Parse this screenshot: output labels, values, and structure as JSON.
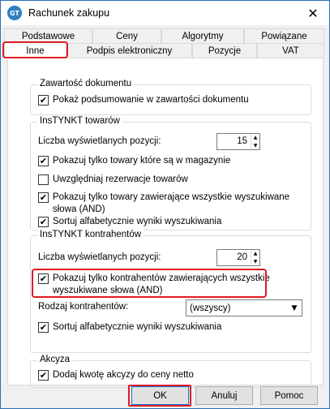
{
  "window": {
    "title": "Rachunek zakupu",
    "icon": "app-logo-icon",
    "icon_text": "GT",
    "close_symbol": "✕"
  },
  "tabs_back_row": [
    "Podstawowe",
    "Ceny",
    "Algorytmy",
    "Powiązane"
  ],
  "tabs_front_row": [
    "Inne",
    "Podpis elektroniczny",
    "Pozycje",
    "VAT"
  ],
  "active_tab": "Inne",
  "groups": {
    "zawartosc": {
      "title": "Zawartość dokumentu",
      "items": [
        {
          "label": "Pokaż podsumowanie w zawartości dokumentu",
          "checked": true
        }
      ]
    },
    "towary": {
      "title": "InsTYNKT towarów",
      "count_label": "Liczba wyświetlanych pozycji:",
      "count_value": "15",
      "items": [
        {
          "label": "Pokazuj tylko towary które są w magazynie",
          "checked": true
        },
        {
          "label": "Uwzględniaj rezerwacje towarów",
          "checked": false
        },
        {
          "label": "Pokazuj tylko towary zawierające wszystkie wyszukiwane słowa (AND)",
          "line1": "Pokazuj tylko towary zawierające wszystkie wyszukiwane",
          "line2": "słowa (AND)",
          "checked": true
        },
        {
          "label": "Sortuj alfabetycznie wyniki wyszukiwania",
          "checked": true
        }
      ]
    },
    "kontrahenci": {
      "title": "InsTYNKT kontrahentów",
      "count_label": "Liczba wyświetlanych pozycji:",
      "count_value": "20",
      "items": [
        {
          "label": "Pokazuj tylko kontrahentów zawierających wszystkie wyszukiwane słowa (AND)",
          "line1": "Pokazuj tylko kontrahentów zawierających wszystkie",
          "line2": "wyszukiwane słowa (AND)",
          "checked": true
        },
        {
          "label": "Sortuj alfabetycznie wyniki wyszukiwania",
          "checked": true
        }
      ],
      "type_label": "Rodzaj kontrahentów:",
      "type_value": "(wszyscy)"
    },
    "akcyza": {
      "title": "Akcyza",
      "items": [
        {
          "label": "Dodaj kwotę akcyzy do ceny netto",
          "checked": true
        }
      ]
    }
  },
  "buttons": {
    "ok": "OK",
    "cancel": "Anuluj",
    "help": "Pomoc"
  },
  "symbols": {
    "check": "✔",
    "spin_up": "▲",
    "spin_down": "▼",
    "dropdown": "▼"
  },
  "colors": {
    "highlight": "#e01a22",
    "accent": "#0078d7",
    "window_border": "#2b6fb5"
  }
}
